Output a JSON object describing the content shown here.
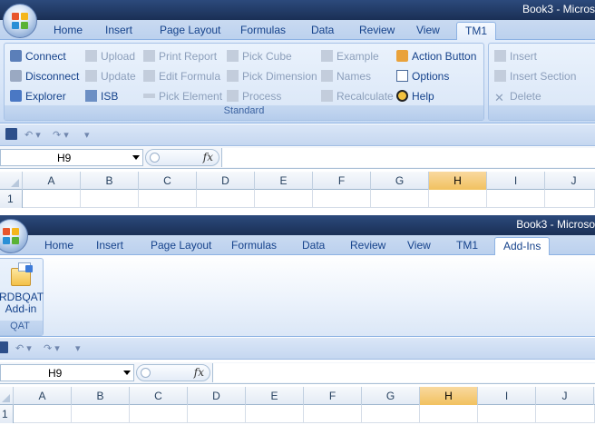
{
  "window1": {
    "title": "Book3 - Micros",
    "tabs": [
      "Home",
      "Insert",
      "Page Layout",
      "Formulas",
      "Data",
      "Review",
      "View",
      "TM1"
    ],
    "active_tab": "TM1",
    "group_standard": {
      "caption": "Standard",
      "col1": [
        "Connect",
        "Disconnect",
        "Explorer"
      ],
      "col2": [
        "Upload",
        "Update",
        "ISB"
      ],
      "col3": [
        "Print Report",
        "Edit Formula",
        "Pick Element"
      ],
      "col4": [
        "Pick Cube",
        "Pick Dimension",
        "Process"
      ],
      "col5": [
        "Example",
        "Names",
        "Recalculate"
      ],
      "col6": [
        "Action Button",
        "Options",
        "Help"
      ]
    },
    "group_right": [
      "Insert",
      "Insert Section",
      "Delete"
    ],
    "name_box": "H9",
    "fx": "fx",
    "columns": [
      "A",
      "B",
      "C",
      "D",
      "E",
      "F",
      "G",
      "H",
      "I",
      "J"
    ],
    "selected_column": "H",
    "rows": [
      "1"
    ]
  },
  "window2": {
    "title": "Book3 - Microso",
    "tabs": [
      "Home",
      "Insert",
      "Page Layout",
      "Formulas",
      "Data",
      "Review",
      "View",
      "TM1",
      "Add-Ins"
    ],
    "active_tab": "Add-Ins",
    "group_qat": {
      "caption": "QAT",
      "button_line1": "RDBQAT",
      "button_line2": "Add-in"
    },
    "name_box": "H9",
    "fx": "fx",
    "columns": [
      "A",
      "B",
      "C",
      "D",
      "E",
      "F",
      "G",
      "H",
      "I",
      "J"
    ],
    "selected_column": "H",
    "rows": [
      "1"
    ]
  },
  "colors": {
    "accent_blue": "#15428b",
    "disabled": "#8c9fbb",
    "selected_header": "#f1c15f"
  }
}
